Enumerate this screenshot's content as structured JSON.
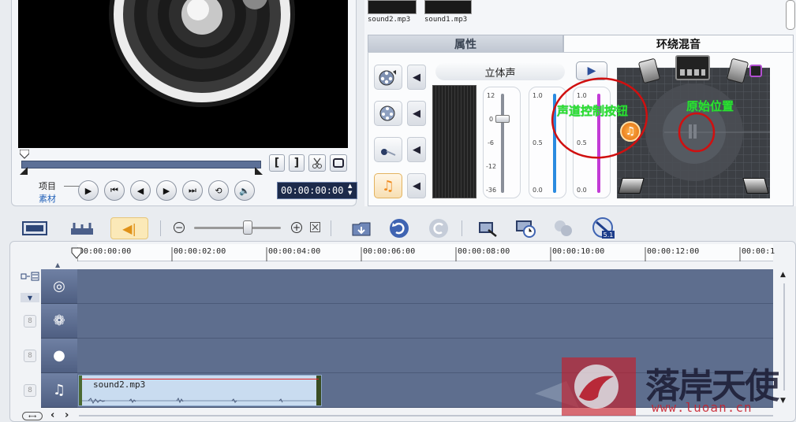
{
  "library": {
    "clips": [
      {
        "label": "sound2.mp3"
      },
      {
        "label": "sound1.mp3"
      }
    ]
  },
  "preview": {
    "mode_project": "项目",
    "mode_clip": "素材",
    "timecode": "00:00:00:00",
    "bracket_in": "[",
    "bracket_out": "]"
  },
  "tabs": [
    {
      "label": "属性",
      "active": false
    },
    {
      "label": "环绕混音",
      "active": true
    }
  ],
  "surround": {
    "stereo_label": "立体声",
    "play_label": "▶",
    "volume_scale": [
      "12",
      "0",
      "-6",
      "-12",
      "-36"
    ],
    "mix_scale_a": [
      "1.0",
      "0.5",
      "0.0"
    ],
    "mix_scale_b": [
      "1.0",
      "0.5",
      "0.0"
    ],
    "annotation_left": "声道控制按钮",
    "annotation_right": "原始位置",
    "track_icons": [
      "video-track-icon",
      "overlay-track-icon",
      "voice-track-icon",
      "music-track-icon"
    ]
  },
  "toolbar": {
    "zoom_out": "−",
    "zoom_in": "+",
    "zoom_level": 0.62
  },
  "timeline": {
    "ruler": [
      "00:00:00:00",
      "00:00:02:00",
      "00:00:04:00",
      "00:00:06:00",
      "00:00:08:00",
      "00:00:10:00",
      "00:00:12:00",
      "00:00:1"
    ],
    "lock_glyph": "8",
    "music_clip_label": "sound2.mp3",
    "scroll_up": "▲",
    "scroll_down": "▼",
    "nav_left": "‹",
    "nav_right": "›"
  },
  "watermark": {
    "text": "落岸天使",
    "url": "www.luoan.cn"
  },
  "colors": {
    "track": "#5e6e8e",
    "clip": "#c9dcf0",
    "accent": "#f08a1c",
    "annotation": "#d01010"
  }
}
